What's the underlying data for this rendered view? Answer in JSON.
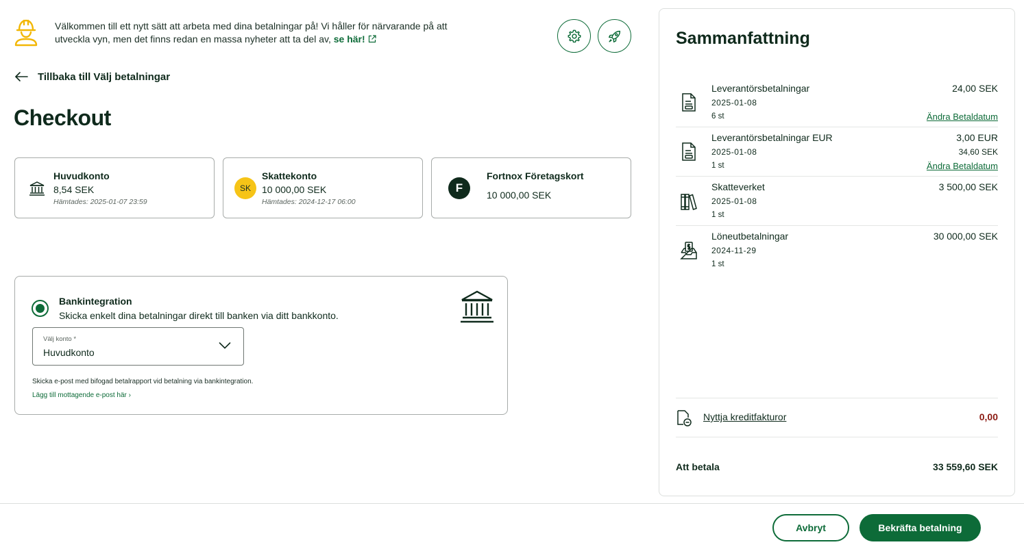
{
  "banner": {
    "text": "Välkommen till ett nytt sätt att arbeta med dina betalningar på! Vi håller för närvarande på att utveckla vyn, men det finns redan en massa nyheter att ta del av,",
    "link": "se här!",
    "icon": "construction-worker-icon"
  },
  "back_link": "Tillbaka till Välj betalningar",
  "page_title": "Checkout",
  "accounts": [
    {
      "name": "Huvudkonto",
      "amount": "8,54 SEK",
      "fetched": "Hämtades: 2025-01-07 23:59",
      "icon": "bank-icon"
    },
    {
      "name": "Skattekonto",
      "amount": "10 000,00 SEK",
      "fetched": "Hämtades: 2024-12-17 06:00",
      "badge": "SK"
    },
    {
      "name": "Fortnox Företagskort",
      "amount": "10 000,00 SEK",
      "badge": "F"
    }
  ],
  "bank_integration": {
    "title": "Bankintegration",
    "description": "Skicka enkelt dina betalningar direkt till banken via ditt bankkonto.",
    "select_label": "Välj konto *",
    "select_value": "Huvudkonto",
    "email_note": "Skicka e-post med bifogad betalrapport vid betalning via bankintegration.",
    "add_recipient": "Lägg till mottagende e-post här ›"
  },
  "summary": {
    "title": "Sammanfattning",
    "items": [
      {
        "name": "Leverantörsbetalningar",
        "date": "2025-01-08",
        "count": "6 st",
        "amount": "24,00 SEK",
        "link": "Ändra Betaldatum",
        "icon": "invoice-document-icon"
      },
      {
        "name": "Leverantörsbetalningar EUR",
        "date": "2025-01-08",
        "count": "1 st",
        "amount": "3,00 EUR",
        "amount_sek": "34,60 SEK",
        "link": "Ändra Betaldatum",
        "icon": "invoice-document-icon"
      },
      {
        "name": "Skatteverket",
        "date": "2025-01-08",
        "count": "1 st",
        "amount": "3 500,00 SEK",
        "icon": "books-icon"
      },
      {
        "name": "Löneutbetalningar",
        "date": "2024-11-29",
        "count": "1 st",
        "amount": "30 000,00 SEK",
        "icon": "salary-inbox-icon"
      }
    ],
    "credit_label": "Nyttja kreditfakturor",
    "credit_value": "0,00",
    "total_label": "Att betala",
    "total_value": "33 559,60 SEK"
  },
  "buttons": {
    "cancel": "Avbryt",
    "confirm": "Bekräfta betalning"
  },
  "colors": {
    "brand_green": "#0d6b38",
    "dark_text": "#0f2a1c",
    "sk_badge": "#f6c417",
    "credit_red": "#8b1a12"
  }
}
